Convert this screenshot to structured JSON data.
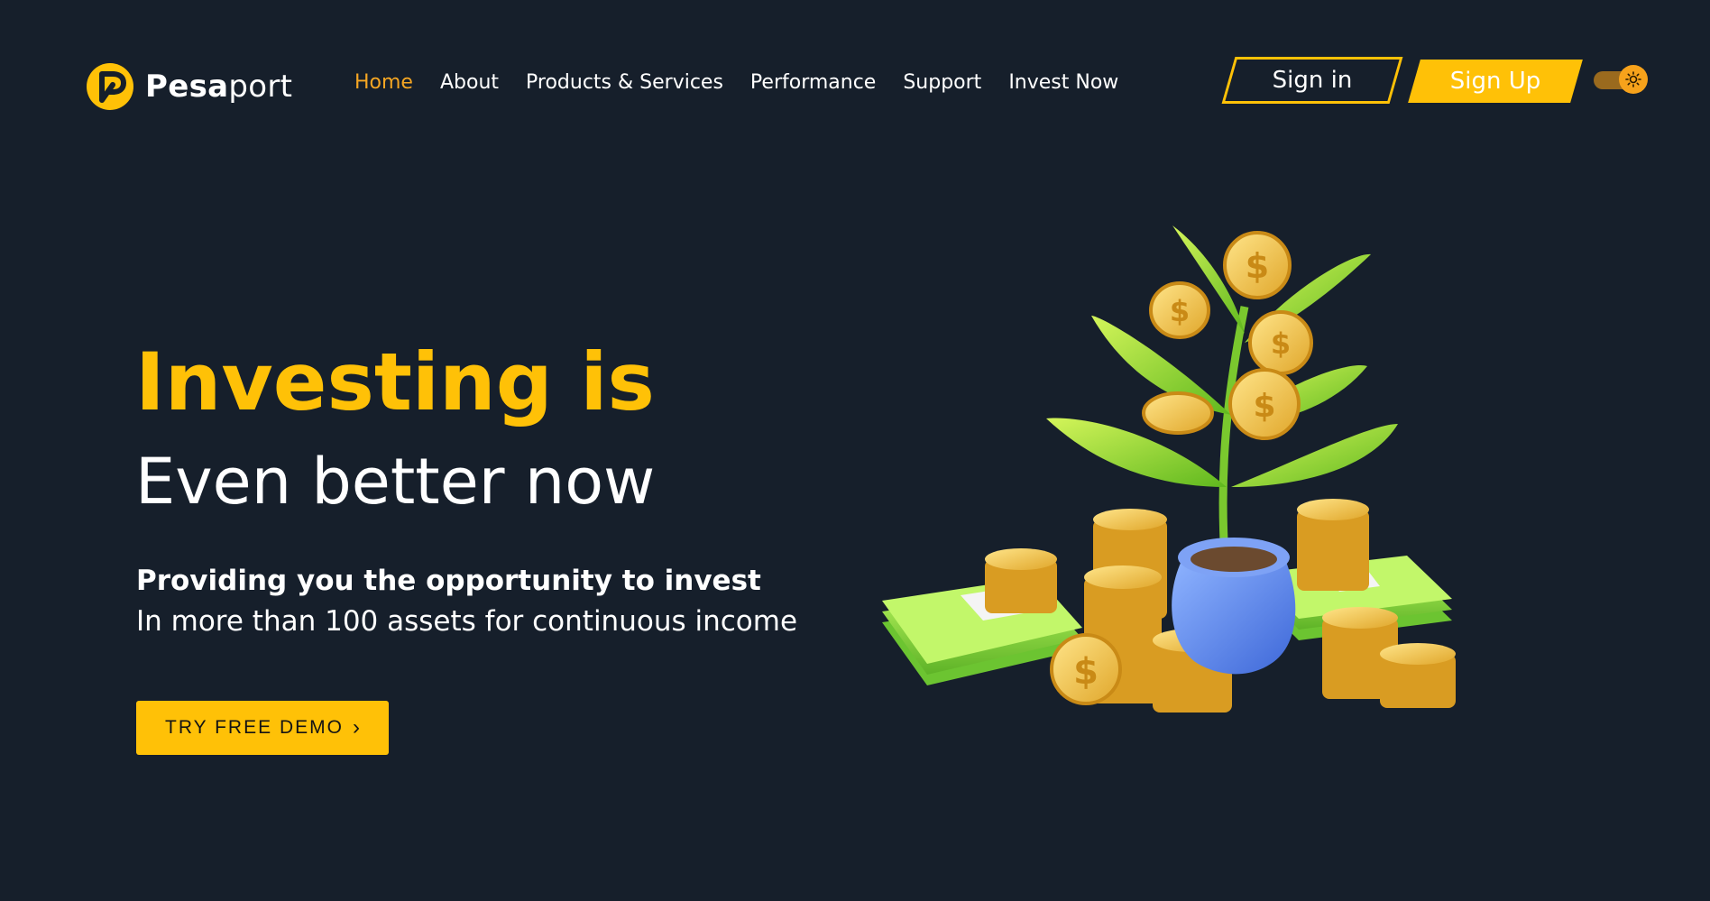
{
  "header": {
    "logo": {
      "text_bold": "Pesa",
      "text_light": "port"
    },
    "nav": [
      {
        "label": "Home",
        "active": true
      },
      {
        "label": "About",
        "active": false
      },
      {
        "label": "Products & Services",
        "active": false
      },
      {
        "label": "Performance",
        "active": false
      },
      {
        "label": "Support",
        "active": false
      },
      {
        "label": "Invest Now",
        "active": false
      }
    ],
    "sign_in_label": "Sign in",
    "sign_up_label": "Sign Up",
    "theme_toggle": {
      "icon": "sun-icon"
    }
  },
  "hero": {
    "title": "Investing is",
    "subtitle": "Even better now",
    "tagline_bold": "Providing you the opportunity to invest",
    "tagline": "In more than 100 assets for continuous income",
    "cta_label": "TRY FREE DEMO",
    "cta_icon": "chevron-right-icon",
    "illustration": "money-plant-illustration"
  },
  "colors": {
    "background": "#161f2b",
    "accent": "#ffc107",
    "nav_active": "#f5a623",
    "text": "#ffffff",
    "toggle_knob": "#f7a21b"
  }
}
